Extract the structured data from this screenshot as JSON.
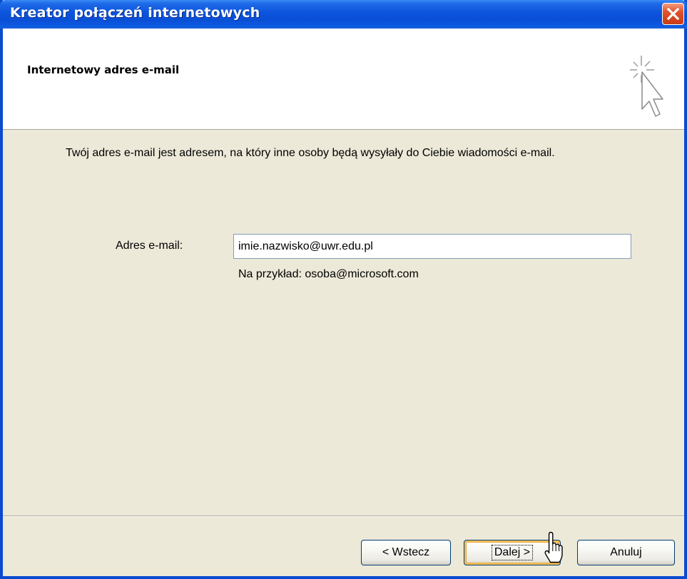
{
  "window": {
    "title": "Kreator połączeń internetowych",
    "close_icon": "close-icon"
  },
  "header": {
    "title": "Internetowy adres e-mail",
    "icon": "wizard-pointer-icon"
  },
  "body": {
    "description": "Twój adres e-mail jest adresem, na który inne osoby będą wysyłały do Ciebie wiadomości e-mail.",
    "email_label": "Adres e-mail:",
    "email_value": "imie.nazwisko@uwr.edu.pl",
    "example_text": "Na przykład: osoba@microsoft.com"
  },
  "footer": {
    "back_label": "< Wstecz",
    "next_label": "Dalej >",
    "cancel_label": "Anuluj"
  },
  "colors": {
    "titlebar": "#0a4fd6",
    "window_face": "#ece9d8",
    "close_button": "#d2431c",
    "focus_highlight": "#f5c15a"
  },
  "cursor": "hand-pointer-icon"
}
